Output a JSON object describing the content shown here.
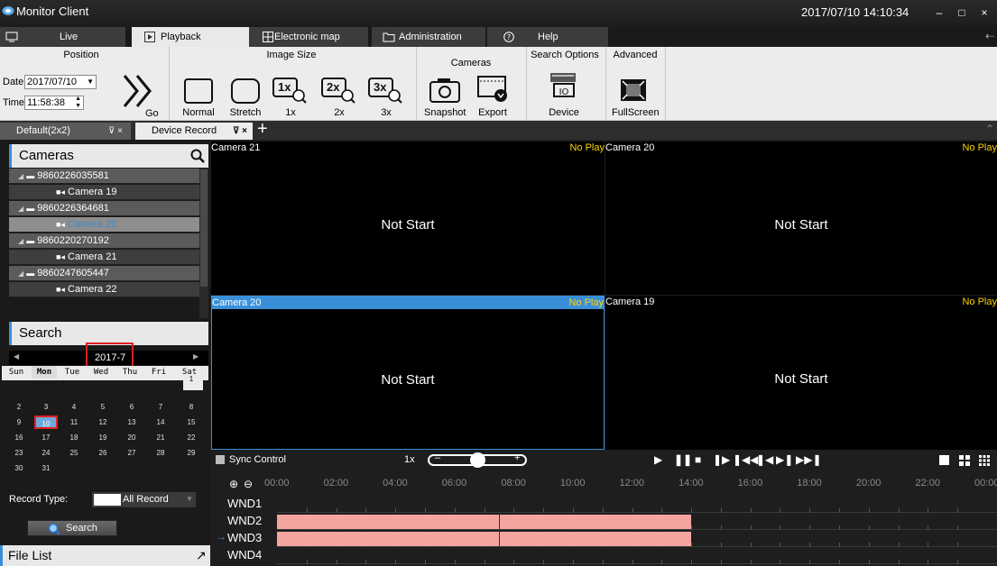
{
  "app": {
    "title": "Monitor Client",
    "clock": "2017/07/10 14:10:34"
  },
  "window_buttons": {
    "minimize": "–",
    "maximize": "□",
    "close": "×"
  },
  "main_tabs": [
    {
      "label": "Live",
      "icon": "monitor-icon"
    },
    {
      "label": "Playback",
      "icon": "play-icon"
    },
    {
      "label": "Electronic map",
      "icon": "map-icon"
    },
    {
      "label": "Administration",
      "icon": "folder-icon"
    },
    {
      "label": "Help",
      "icon": "help-icon"
    }
  ],
  "ribbon": {
    "position": {
      "title": "Position",
      "date_label": "Date",
      "date_value": "2017/07/10",
      "time_label": "Time",
      "time_value": "11:58:38",
      "go_label": "Go"
    },
    "image_size": {
      "title": "Image Size",
      "normal": "Normal",
      "stretch": "Stretch",
      "x1": "1x",
      "x2": "2x",
      "x3": "3x",
      "x1_icon": "1x",
      "x2_icon": "2x",
      "x3_icon": "3x"
    },
    "cameras": {
      "title": "Cameras",
      "snapshot": "Snapshot",
      "export": "Export"
    },
    "search_options": {
      "title": "Search Options",
      "device": "Device"
    },
    "advanced": {
      "title": "Advanced",
      "fullscreen": "FullScreen"
    }
  },
  "doc_tabs": [
    {
      "label": "Default(2x2)"
    },
    {
      "label": "Device Record"
    }
  ],
  "cameras_panel": {
    "title": "Cameras",
    "tree": [
      {
        "type": "device",
        "label": "9860226035581"
      },
      {
        "type": "camera",
        "label": "Camera 19"
      },
      {
        "type": "device",
        "label": "9860226364681"
      },
      {
        "type": "camera",
        "label": "Camera 20",
        "selected": true
      },
      {
        "type": "device",
        "label": "9860220270192"
      },
      {
        "type": "camera",
        "label": "Camera 21"
      },
      {
        "type": "device",
        "label": "9860247605447"
      },
      {
        "type": "camera",
        "label": "Camera 22"
      }
    ]
  },
  "search_panel": {
    "title": "Search",
    "month": "2017-7",
    "weekdays": [
      "Sun",
      "Mon",
      "Tue",
      "Wed",
      "Thu",
      "Fri",
      "Sat"
    ],
    "weeks": [
      [
        "",
        "",
        "",
        "",
        "",
        "",
        "1"
      ],
      [
        "2",
        "3",
        "4",
        "5",
        "6",
        "7",
        "8"
      ],
      [
        "9",
        "10",
        "11",
        "12",
        "13",
        "14",
        "15"
      ],
      [
        "16",
        "17",
        "18",
        "19",
        "20",
        "21",
        "22"
      ],
      [
        "23",
        "24",
        "25",
        "26",
        "27",
        "28",
        "29"
      ],
      [
        "30",
        "31",
        "",
        "",
        "",
        "",
        ""
      ]
    ],
    "selected_day": "10",
    "record_type_label": "Record Type:",
    "record_type_value": "All Record",
    "search_button": "Search",
    "file_list": "File List"
  },
  "video_cells": [
    {
      "camera": "Camera 21",
      "status": "No Play",
      "message": "Not Start",
      "active": false
    },
    {
      "camera": "Camera 20",
      "status": "No Play",
      "message": "Not Start",
      "active": false
    },
    {
      "camera": "Camera 20",
      "status": "No Play",
      "message": "Not Start",
      "active": true
    },
    {
      "camera": "Camera 19",
      "status": "No Play",
      "message": "Not Start",
      "active": false
    }
  ],
  "controls": {
    "sync_label": "Sync Control",
    "speed": "1x",
    "speed_minus": "–",
    "speed_plus": "+"
  },
  "timeline": {
    "ticks": [
      "00:00",
      "02:00",
      "04:00",
      "06:00",
      "08:00",
      "10:00",
      "12:00",
      "14:00",
      "16:00",
      "18:00",
      "20:00",
      "22:00",
      "00:00"
    ],
    "tracks": [
      {
        "label": "WND1",
        "segments": []
      },
      {
        "label": "WND2",
        "segments": [
          {
            "start_hour": 0.0,
            "end_hour": 14.0
          }
        ]
      },
      {
        "label": "WND3",
        "segments": [
          {
            "start_hour": 0.0,
            "end_hour": 14.0
          }
        ],
        "current": true
      },
      {
        "label": "WND4",
        "segments": []
      }
    ],
    "marker_hour": 7.5
  },
  "colors": {
    "accent": "#3a8fd8",
    "no_play": "#ffd400",
    "record": "#f4a5a0",
    "highlight_red": "#e02020"
  }
}
